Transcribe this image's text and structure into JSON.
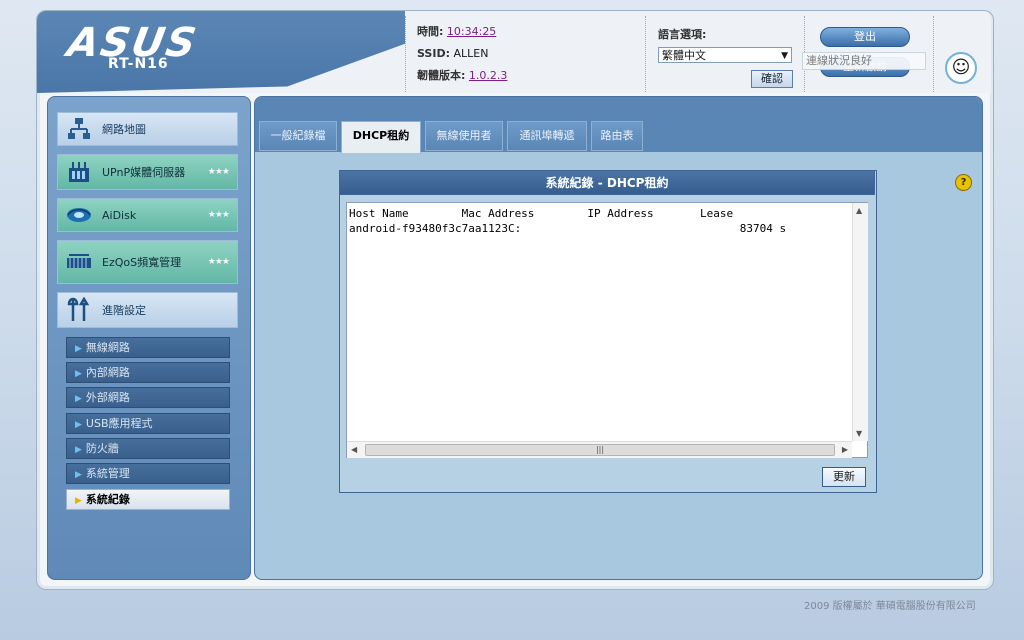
{
  "header": {
    "brand": "ASUS",
    "model": "RT-N16",
    "time_label": "時間:",
    "time_value": "10:34:25",
    "ssid_label": "SSID:",
    "ssid_value": "ALLEN",
    "firmware_label": "韌體版本:",
    "firmware_value": "1.0.2.3",
    "language_label": "語言選項:",
    "language_value": "繁體中文",
    "apply_label": "確認",
    "logout_label": "登出",
    "reboot_label": "重新啟動",
    "tooltip_text": "連線狀況良好"
  },
  "sidebar": {
    "items": [
      {
        "label": "網路地圖",
        "icon": "network-map-icon"
      },
      {
        "label": "UPnP媒體伺服器",
        "icon": "media-server-icon"
      },
      {
        "label": "AiDisk",
        "icon": "aidisk-icon"
      },
      {
        "label": "EzQoS頻寬管理",
        "icon": "qos-icon"
      },
      {
        "label": "進階設定",
        "icon": "tools-icon"
      }
    ],
    "sub_items": [
      "無線網路",
      "內部網路",
      "外部網路",
      "USB應用程式",
      "防火牆",
      "系統管理",
      "系統紀錄"
    ]
  },
  "tabs": [
    "一般紀錄檔",
    "DHCP租約",
    "無線使用者",
    "通訊埠轉遞",
    "路由表"
  ],
  "active_tab": "DHCP租約",
  "panel": {
    "title": "系統紀錄 - DHCP租約",
    "log_lines": [
      "Host Name        Mac Address        IP Address       Lease",
      "android-f93480f3c7aa1123C:                                 83704 s"
    ],
    "refresh_label": "更新"
  },
  "footer": {
    "copyright": "2009 版權屬於 華碩電腦股份有限公司"
  }
}
